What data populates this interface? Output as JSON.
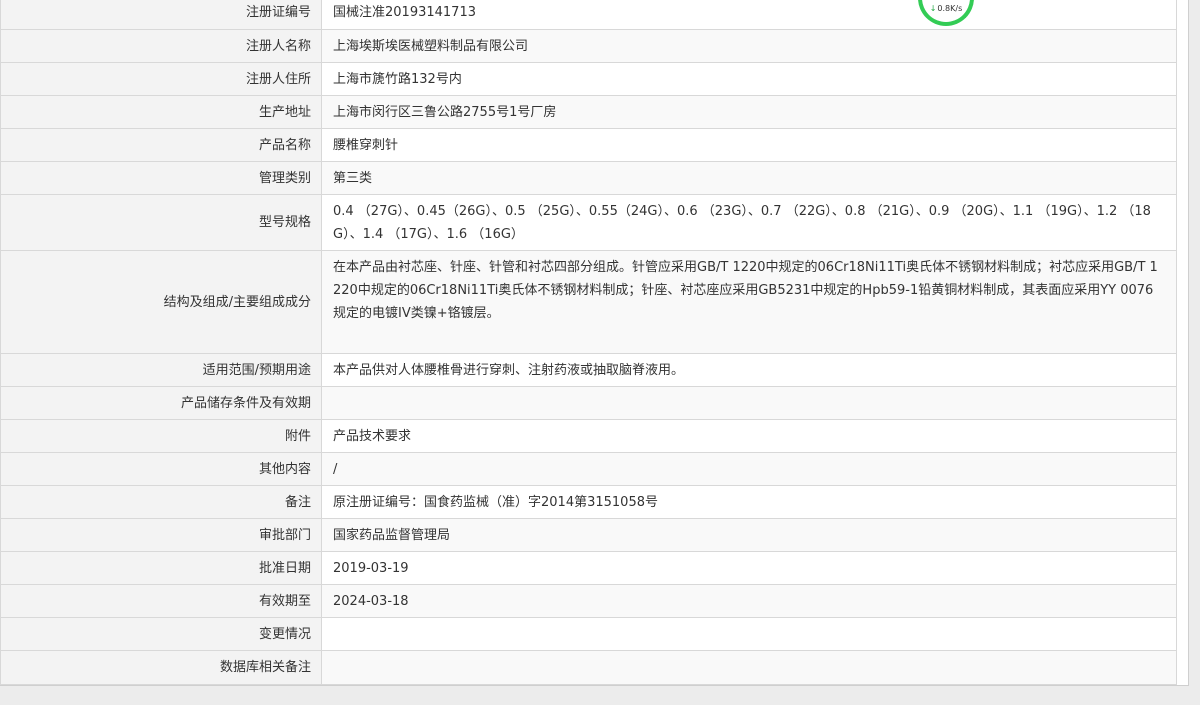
{
  "rows": [
    {
      "label": "注册证编号",
      "value": "国械注准20193141713"
    },
    {
      "label": "注册人名称",
      "value": "上海埃斯埃医械塑料制品有限公司"
    },
    {
      "label": "注册人住所",
      "value": "上海市篪竹路132号内"
    },
    {
      "label": "生产地址",
      "value": "上海市闵行区三鲁公路2755号1号厂房"
    },
    {
      "label": "产品名称",
      "value": "腰椎穿刺针"
    },
    {
      "label": "管理类别",
      "value": "第三类"
    },
    {
      "label": "型号规格",
      "value": "0.4 （27G）、0.45（26G）、0.5 （25G）、0.55（24G）、0.6 （23G）、0.7 （22G）、0.8 （21G）、0.9 （20G）、1.1 （19G）、1.2 （18G）、1.4 （17G）、1.6 （16G）"
    },
    {
      "label": "结构及组成/主要组成成分",
      "value": "在本产品由衬芯座、针座、针管和衬芯四部分组成。针管应采用GB/T 1220中规定的06Cr18Ni11Ti奥氏体不锈钢材料制成；衬芯应采用GB/T 1220中规定的06Cr18Ni11Ti奥氏体不锈钢材料制成；针座、衬芯座应采用GB5231中规定的Hpb59-1铅黄铜材料制成，其表面应采用YY 0076规定的电镀IV类镍+铬镀层。"
    },
    {
      "label": "适用范围/预期用途",
      "value": "本产品供对人体腰椎骨进行穿刺、注射药液或抽取脑脊液用。"
    },
    {
      "label": "产品储存条件及有效期",
      "value": ""
    },
    {
      "label": "附件",
      "value": "产品技术要求"
    },
    {
      "label": "其他内容",
      "value": "/"
    },
    {
      "label": "备注",
      "value": "原注册证编号：国食药监械（准）字2014第3151058号"
    },
    {
      "label": "审批部门",
      "value": "国家药品监督管理局"
    },
    {
      "label": "批准日期",
      "value": "2019-03-19"
    },
    {
      "label": "有效期至",
      "value": "2024-03-18"
    },
    {
      "label": "变更情况",
      "value": ""
    },
    {
      "label": "数据库相关备注",
      "value": ""
    }
  ],
  "speed_widget": {
    "arrow_icon": "down-arrow-icon",
    "text": "0.8K/s"
  }
}
